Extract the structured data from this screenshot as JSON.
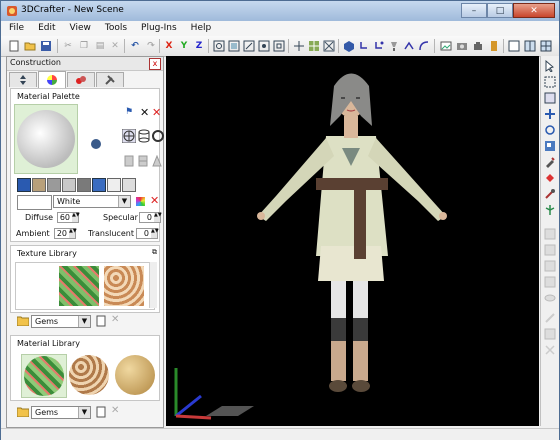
{
  "window": {
    "title": "3DCrafter - New Scene"
  },
  "menu": [
    "File",
    "Edit",
    "View",
    "Tools",
    "Plug-Ins",
    "Help"
  ],
  "toolbar": {
    "x_label": "X",
    "y_label": "Y",
    "z_label": "Z"
  },
  "panel": {
    "title": "Construction",
    "close_label": "x",
    "material_palette_label": "Material Palette",
    "color_select": "White",
    "diffuse_label": "Diffuse",
    "diffuse_value": "60",
    "ambient_label": "Ambient",
    "ambient_value": "20",
    "specular_label": "Specular",
    "specular_value": "0",
    "translucent_label": "Translucent",
    "translucent_value": "0",
    "texture_library_label": "Texture Library",
    "texture_folder": "Gems",
    "material_library_label": "Material Library",
    "material_folder": "Gems"
  },
  "colors": {
    "accent": "#1b4fa0",
    "viewport_bg": "#000000",
    "titlebar": "#b4cbe8"
  }
}
